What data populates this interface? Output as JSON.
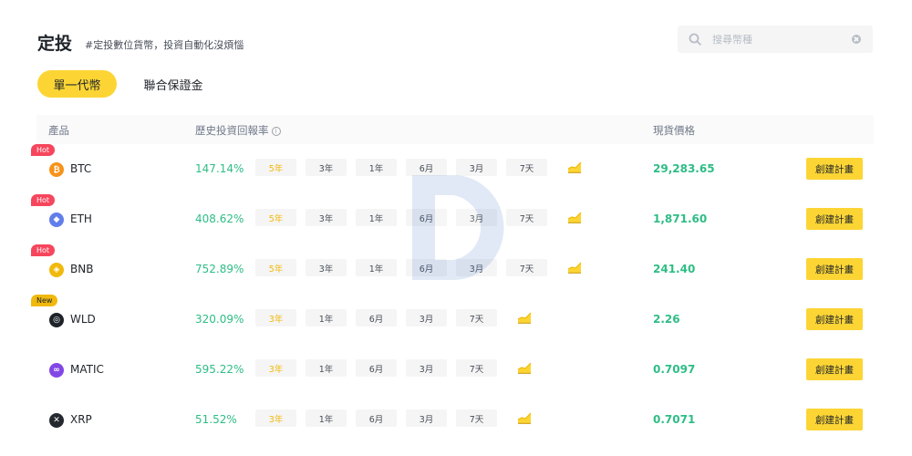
{
  "header": {
    "title": "定投",
    "subtitle": "#定投數位貨幣，投資自動化沒煩惱"
  },
  "search": {
    "placeholder": "搜尋幣種",
    "value": ""
  },
  "tabs": [
    {
      "label": "單一代幣",
      "active": true
    },
    {
      "label": "聯合保證金",
      "active": false
    }
  ],
  "table": {
    "headers": {
      "product": "產品",
      "history": "歷史投資回報率",
      "price": "現貨價格"
    },
    "info_glyph": "i",
    "action_label": "創建計畫",
    "rows": [
      {
        "badge": "Hot",
        "badge_type": "hot",
        "symbol": "BTC",
        "icon": "bitcoin-icon",
        "icon_color": "#f7931a",
        "icon_glyph": "₿",
        "rate": "147.14%",
        "periods": [
          "5年",
          "3年",
          "1年",
          "6月",
          "3月",
          "7天"
        ],
        "selected_period": 0,
        "price": "29,283.65"
      },
      {
        "badge": "Hot",
        "badge_type": "hot",
        "symbol": "ETH",
        "icon": "ethereum-icon",
        "icon_color": "#627eea",
        "icon_glyph": "◆",
        "rate": "408.62%",
        "periods": [
          "5年",
          "3年",
          "1年",
          "6月",
          "3月",
          "7天"
        ],
        "selected_period": 0,
        "price": "1,871.60"
      },
      {
        "badge": "Hot",
        "badge_type": "hot",
        "symbol": "BNB",
        "icon": "bnb-icon",
        "icon_color": "#f0b90b",
        "icon_glyph": "◈",
        "rate": "752.89%",
        "periods": [
          "5年",
          "3年",
          "1年",
          "6月",
          "3月",
          "7天"
        ],
        "selected_period": 0,
        "price": "241.40"
      },
      {
        "badge": "New",
        "badge_type": "new",
        "symbol": "WLD",
        "icon": "worldcoin-icon",
        "icon_color": "#1e2329",
        "icon_glyph": "◎",
        "rate": "320.09%",
        "periods": [
          "3年",
          "1年",
          "6月",
          "3月",
          "7天"
        ],
        "selected_period": 0,
        "price": "2.26"
      },
      {
        "badge": "",
        "badge_type": "",
        "symbol": "MATIC",
        "icon": "polygon-icon",
        "icon_color": "#8247e5",
        "icon_glyph": "∞",
        "rate": "595.22%",
        "periods": [
          "3年",
          "1年",
          "6月",
          "3月",
          "7天"
        ],
        "selected_period": 0,
        "price": "0.7097"
      },
      {
        "badge": "",
        "badge_type": "",
        "symbol": "XRP",
        "icon": "xrp-icon",
        "icon_color": "#23292f",
        "icon_glyph": "✕",
        "rate": "51.52%",
        "periods": [
          "3年",
          "1年",
          "6月",
          "3月",
          "7天"
        ],
        "selected_period": 0,
        "price": "0.7071"
      }
    ]
  },
  "colors": {
    "accent": "#fcd535",
    "positive": "#2ebd85",
    "hot": "#f6465d",
    "new": "#f0b90b"
  }
}
